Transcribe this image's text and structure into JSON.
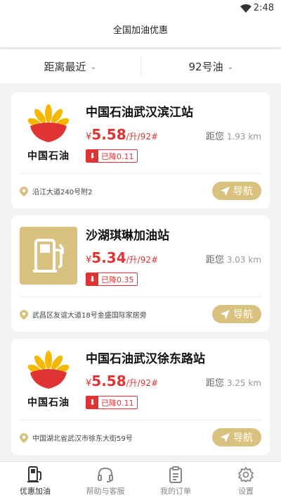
{
  "status_bar": {
    "time": "2:48"
  },
  "header": {
    "title": "全国加油优惠"
  },
  "filters": [
    {
      "label": "距离最近"
    },
    {
      "label": "92号油"
    }
  ],
  "stations": [
    {
      "logo": "cnpc",
      "brand_text": "中国石油",
      "name": "中国石油武汉滨江站",
      "currency": "¥",
      "price": "5.58",
      "unit": "/升/92#",
      "distance_label": "距您",
      "distance": "1.93 km",
      "discount": "已降0.11",
      "address": "沿江大道240号附2",
      "nav_label": "导航"
    },
    {
      "logo": "gas-pump",
      "brand_text": "",
      "name": "沙湖琪琳加油站",
      "currency": "¥",
      "price": "5.34",
      "unit": "/升/92#",
      "distance_label": "距您",
      "distance": "3.03 km",
      "discount": "已降0.35",
      "address": "武昌区友谊大道18号金盛国际家居旁",
      "nav_label": "导航"
    },
    {
      "logo": "cnpc",
      "brand_text": "中国石油",
      "name": "中国石油武汉徐东路站",
      "currency": "¥",
      "price": "5.58",
      "unit": "/升/92#",
      "distance_label": "距您",
      "distance": "3.25 km",
      "discount": "已降0.11",
      "address": "中国湖北省武汉市徐东大街59号",
      "nav_label": "导航"
    }
  ],
  "bottom_nav": [
    {
      "label": "优惠加油",
      "icon": "gas-pump-icon",
      "active": true
    },
    {
      "label": "帮助与客服",
      "icon": "headset-icon",
      "active": false
    },
    {
      "label": "我的订单",
      "icon": "clipboard-icon",
      "active": false
    },
    {
      "label": "设置",
      "icon": "gear-icon",
      "active": false
    }
  ],
  "colors": {
    "accent": "#d9c17f",
    "price": "#e03434"
  }
}
